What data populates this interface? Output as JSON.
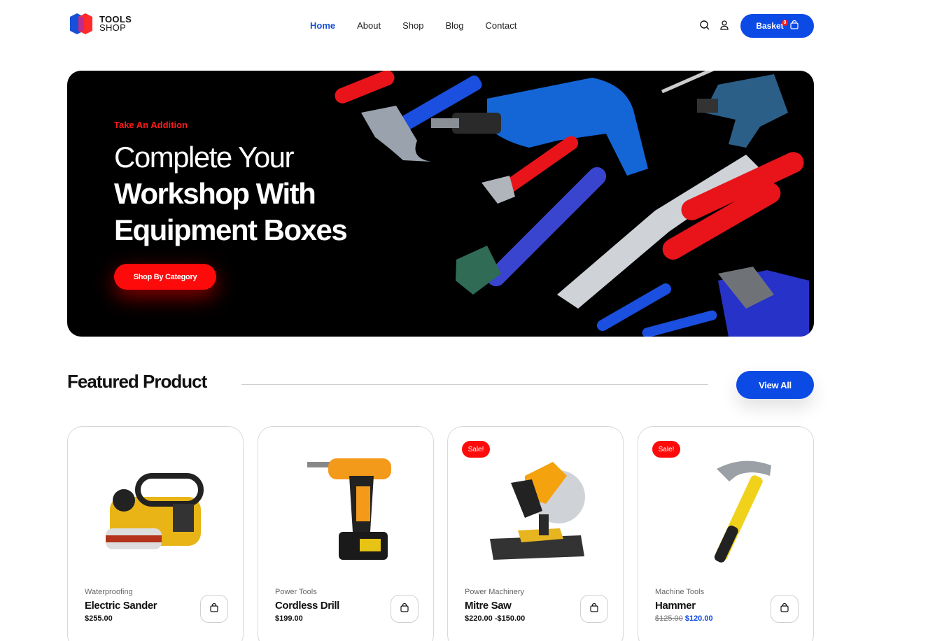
{
  "brand": {
    "line1": "TOOLS",
    "line2": "SHOP",
    "colors": {
      "blue": "#1650d8",
      "red": "#ff2b2b"
    }
  },
  "nav": {
    "items": [
      {
        "label": "Home",
        "active": true
      },
      {
        "label": "About",
        "active": false
      },
      {
        "label": "Shop",
        "active": false
      },
      {
        "label": "Blog",
        "active": false
      },
      {
        "label": "Contact",
        "active": false
      }
    ]
  },
  "header_icons": {
    "search": "search-icon",
    "account": "user-icon"
  },
  "basket": {
    "label": "Basket",
    "count": "0",
    "icon": "bag-icon"
  },
  "hero": {
    "eyebrow": "Take An Addition",
    "title_line1": "Complete Your",
    "title_line2": "Workshop With",
    "title_line3": "Equipment Boxes",
    "cta": "Shop By Category"
  },
  "featured": {
    "title": "Featured Product",
    "view_all": "View All",
    "products": [
      {
        "category": "Waterproofing",
        "name": "Electric Sander",
        "price": "$255.00",
        "sale": false
      },
      {
        "category": "Power Tools",
        "name": "Cordless Drill",
        "price": "$199.00",
        "sale": false
      },
      {
        "category": "Power Machinery",
        "name": "Mitre Saw",
        "price": "$220.00 -$150.00",
        "sale": true,
        "sale_label": "Sale!"
      },
      {
        "category": "Machine Tools",
        "name": "Hammer",
        "old_price": "$125.00",
        "new_price": "$120.00",
        "sale": true,
        "sale_label": "Sale!"
      }
    ]
  },
  "colors": {
    "primary": "#0c4ae6",
    "accent": "#ff0a0a"
  }
}
